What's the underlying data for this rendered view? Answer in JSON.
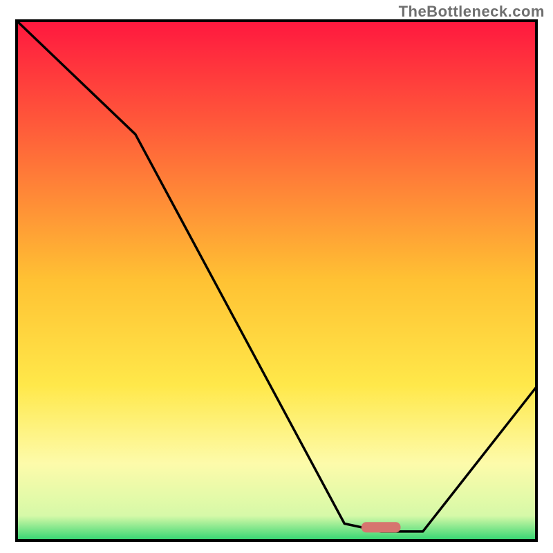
{
  "watermark": "TheBottleneck.com",
  "chart_data": {
    "type": "line",
    "x": [
      0.0,
      0.23,
      0.63,
      0.7,
      0.78,
      1.0
    ],
    "series": [
      {
        "name": "curve",
        "values": [
          1.0,
          0.78,
          0.035,
          0.02,
          0.02,
          0.3
        ]
      }
    ],
    "xlim": [
      0,
      1
    ],
    "ylim": [
      0,
      1
    ],
    "gradient_stops": [
      {
        "offset": 0.0,
        "color": "#ff173f"
      },
      {
        "offset": 0.2,
        "color": "#ff593a"
      },
      {
        "offset": 0.5,
        "color": "#ffc233"
      },
      {
        "offset": 0.7,
        "color": "#ffe84a"
      },
      {
        "offset": 0.85,
        "color": "#fdfbaa"
      },
      {
        "offset": 0.95,
        "color": "#d6f9a8"
      },
      {
        "offset": 1.0,
        "color": "#27d36e"
      }
    ],
    "marker": {
      "x": 0.7,
      "y": 0.028,
      "width_frac": 0.075,
      "height_frac": 0.02,
      "color": "#d6756f"
    },
    "title": "",
    "xlabel": "",
    "ylabel": ""
  }
}
